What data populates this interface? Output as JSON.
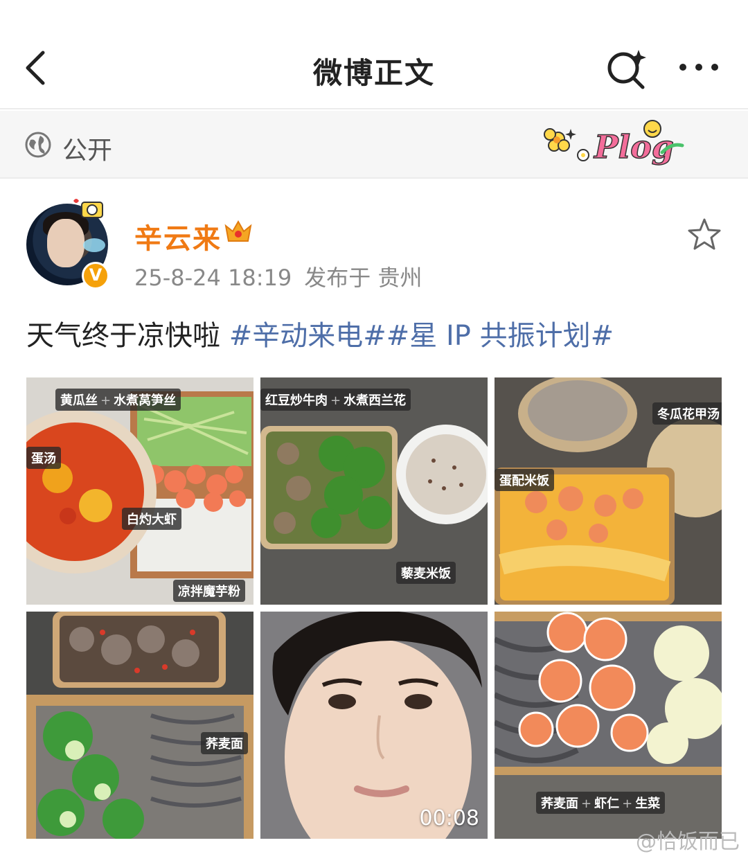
{
  "header": {
    "title": "微博正文"
  },
  "visibility": {
    "label": "公开"
  },
  "author": {
    "name": "辛云来",
    "time": "25-8-24 18:19",
    "location": "发布于 贵州",
    "badge": "V"
  },
  "post": {
    "text": "天气终于凉快啦 ",
    "topics": [
      "#辛动来电#",
      "#星 IP 共振计划#"
    ]
  },
  "grid": {
    "img1": {
      "labels": [
        "黄瓜丝",
        "水煮莴笋丝",
        "蛋汤",
        "白灼大虾",
        "凉拌魔芋粉"
      ]
    },
    "img2": {
      "labels": [
        "红豆炒牛肉",
        "水煮西兰花",
        "藜麦米饭"
      ]
    },
    "img3": {
      "labels": [
        "冬瓜花甲汤",
        "蛋配米饭"
      ]
    },
    "img4": {
      "labels": [
        "荞麦面"
      ]
    },
    "img5": {
      "duration": "00:08"
    },
    "img6": {
      "labels": [
        "荞麦面",
        "虾仁",
        "生菜"
      ]
    }
  },
  "watermark": "@恰饭而已",
  "icons": [
    "back-icon",
    "search-ai-icon",
    "more-icon",
    "globe-icon",
    "plog-sticker",
    "crown-icon",
    "star-icon",
    "verified-badge-icon"
  ]
}
